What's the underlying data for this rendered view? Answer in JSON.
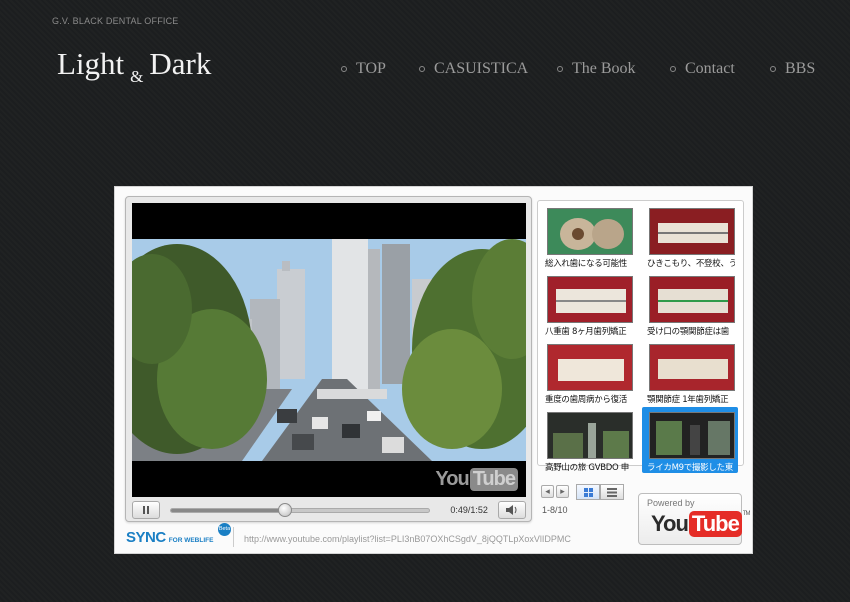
{
  "site": {
    "office": "G.V. BLACK DENTAL OFFICE",
    "logo_light": "Light",
    "logo_amp": "&",
    "logo_dark": "Dark"
  },
  "nav": {
    "items": [
      {
        "label": "TOP"
      },
      {
        "label": "CASUISTICA"
      },
      {
        "label": "The Book"
      },
      {
        "label": "Contact"
      },
      {
        "label": "BBS"
      }
    ]
  },
  "player": {
    "watermark_you": "You",
    "watermark_tube": "Tube",
    "time": "0:49/1:52",
    "progress": 0.44
  },
  "playlist": {
    "items": [
      {
        "caption": "総入れ歯になる可能性",
        "active": false
      },
      {
        "caption": "ひきこもり、不登校、うつ",
        "active": false
      },
      {
        "caption": "八重歯 8ヶ月歯列矯正",
        "active": false
      },
      {
        "caption": "受け口の顎関節症は歯",
        "active": false
      },
      {
        "caption": "重度の歯周病から復活",
        "active": false
      },
      {
        "caption": "顎関節症 1年歯列矯正",
        "active": false
      },
      {
        "caption": "高野山の旅 GVBDO 申",
        "active": false
      },
      {
        "caption": "ライカM9で撮影した東",
        "active": true
      }
    ],
    "pager_prev": "◂",
    "pager_next": "▸",
    "range": "1-8/10"
  },
  "powered": {
    "label": "Powered by",
    "you": "You",
    "tube": "Tube",
    "tm": "TM"
  },
  "footer": {
    "sync": "SYNC",
    "sync_sub": "FOR WEBLIFE",
    "beta": "Beta",
    "url": "http://www.youtube.com/playlist?list=PLI3nB07OXhCSgdV_8jQQTLpXoxVlIDPMC"
  },
  "colors": {
    "background": "#1d1f20",
    "accent": "#1f8ee6",
    "youtube_red": "#e52d27"
  }
}
